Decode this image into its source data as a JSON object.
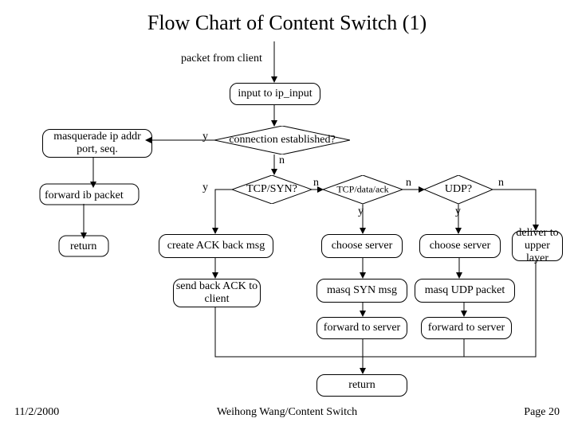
{
  "title": "Flow Chart of Content Switch (1)",
  "labels": {
    "packet_from_client": "packet from client",
    "input_to_ip_input": "input to ip_input",
    "masquerade": "masquerade ip addr port, seq.",
    "forward_ib": "forward ib packet",
    "return_left": "return",
    "conn_est": "connection established?",
    "tcp_syn": "TCP/SYN?",
    "tcp_data_ack": "TCP/data/ack",
    "udp": "UDP?",
    "create_ack": "create ACK back msg",
    "send_back_ack": "send back ACK to client",
    "choose_server1": "choose server",
    "masq_syn": "masq SYN msg",
    "forward_server1": "forward to server",
    "choose_server2": "choose server",
    "masq_udp": "masq UDP packet",
    "forward_server2": "forward to server",
    "deliver_upper": "deliver to upper layer",
    "return_bottom": "return",
    "y": "y",
    "n": "n"
  },
  "footer": {
    "date": "11/2/2000",
    "center": "Weihong Wang/Content Switch",
    "page": "Page 20"
  }
}
